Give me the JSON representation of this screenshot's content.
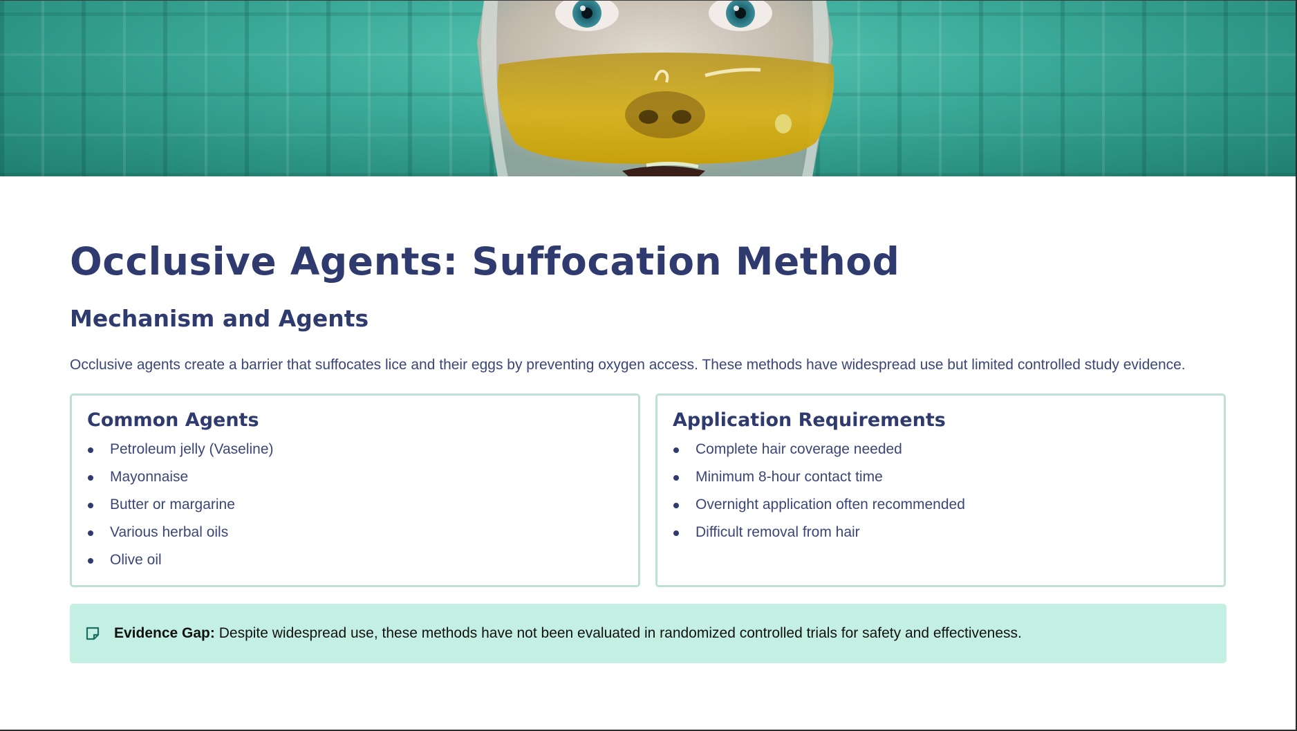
{
  "hero": {
    "image_description_icon": "face-with-yellow-visor-image"
  },
  "slide": {
    "title": "Occlusive Agents: Suffocation Method",
    "subtitle": "Mechanism and Agents",
    "intro": "Occlusive agents create a barrier that suffocates lice and their eggs by preventing oxygen access. These methods have widespread use but limited controlled study evidence."
  },
  "cards": {
    "left": {
      "heading": "Common Agents",
      "items": [
        "Petroleum jelly (Vaseline)",
        "Mayonnaise",
        "Butter or margarine",
        "Various herbal oils",
        "Olive oil"
      ]
    },
    "right": {
      "heading": "Application Requirements",
      "items": [
        "Complete hair coverage needed",
        "Minimum 8-hour contact time",
        "Overnight application often recommended",
        "Difficult removal from hair"
      ]
    }
  },
  "callout": {
    "icon": "note-icon",
    "label": "Evidence Gap:",
    "text": " Despite widespread use, these methods have not been evaluated in randomized controlled trials for safety and effectiveness."
  },
  "colors": {
    "heading": "#2f3b6e",
    "body_text": "#3a4677",
    "card_border": "#bfe0d8",
    "callout_bg": "#c4f0e3",
    "hero_teal": "#3aa896"
  }
}
